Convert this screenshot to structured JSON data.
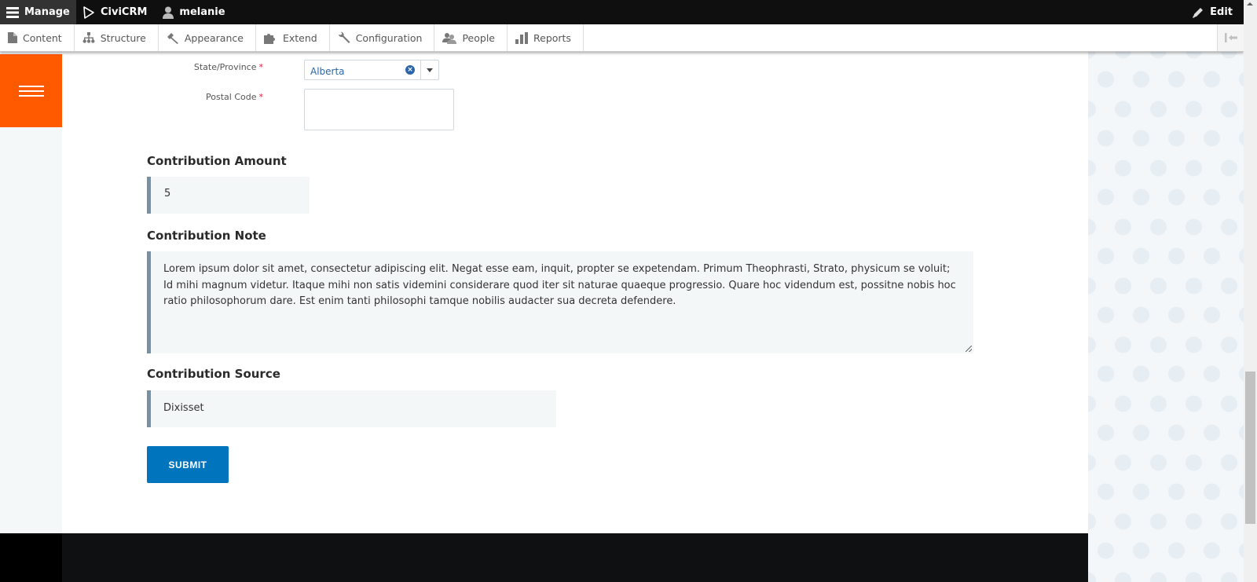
{
  "admin_bar": {
    "manage_label": "Manage",
    "civicrm_label": "CiviCRM",
    "user_label": "melanie",
    "edit_label": "Edit"
  },
  "toolbar": {
    "items": [
      {
        "label": "Content",
        "icon": "file-icon"
      },
      {
        "label": "Structure",
        "icon": "sitemap-icon"
      },
      {
        "label": "Appearance",
        "icon": "paintbrush-icon"
      },
      {
        "label": "Extend",
        "icon": "puzzle-icon"
      },
      {
        "label": "Configuration",
        "icon": "wrench-icon"
      },
      {
        "label": "People",
        "icon": "people-icon"
      },
      {
        "label": "Reports",
        "icon": "bar-chart-icon"
      }
    ]
  },
  "form": {
    "state_label": "State/Province",
    "state_value": "Alberta",
    "postal_label": "Postal Code",
    "postal_value": "",
    "required_mark": "*",
    "amount_title": "Contribution Amount",
    "amount_value": "5",
    "note_title": "Contribution Note",
    "note_value": "Lorem ipsum dolor sit amet, consectetur adipiscing elit. Negat esse eam, inquit, propter se expetendam. Primum Theophrasti, Strato, physicum se voluit; Id mihi magnum videtur. Itaque mihi non satis videmini considerare quod iter sit naturae quaeque progressio. Quare hoc videndum est, possitne nobis hoc ratio philosophorum dare. Est enim tanti philosophi tamque nobilis audacter sua decreta defendere.",
    "source_title": "Contribution Source",
    "source_value": "Dixisset",
    "submit_label": "SUBMIT"
  },
  "colors": {
    "menu_accent": "#ff5a00",
    "submit_blue": "#0074bd",
    "select_text": "#2c66a8",
    "field_border": "#7591a2",
    "required": "#e0223a"
  }
}
